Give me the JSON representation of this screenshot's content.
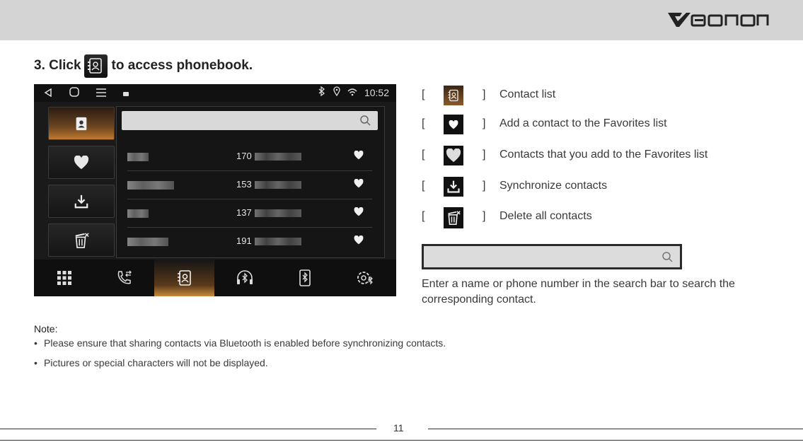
{
  "header": {
    "brand": "EONON"
  },
  "step": {
    "before": "3. Click",
    "after": "to access phonebook."
  },
  "phone": {
    "time": "10:52",
    "contacts": [
      {
        "number": "170"
      },
      {
        "number": "153"
      },
      {
        "number": "137"
      },
      {
        "number": "191"
      }
    ],
    "dock_icons": [
      "apps-grid-icon",
      "call-log-icon",
      "contacts-icon",
      "bluetooth-headset-icon",
      "bluetooth-phone-icon",
      "bluetooth-settings-icon"
    ]
  },
  "legend": [
    {
      "icon": "contact-list-icon",
      "text": "Contact list"
    },
    {
      "icon": "heart-add-icon",
      "text": "Add a contact to the Favorites list"
    },
    {
      "icon": "heart-favorites-icon",
      "text": "Contacts that you add to the Favorites list"
    },
    {
      "icon": "download-icon",
      "text": "Synchronize contacts"
    },
    {
      "icon": "trash-icon",
      "text": "Delete all contacts"
    }
  ],
  "bracket_open": "[",
  "bracket_close": "]",
  "search_description": "Enter a name or phone number in the search bar to search the corresponding contact.",
  "note": {
    "heading": "Note:",
    "bullet": "•",
    "items": [
      "Please ensure that sharing contacts via Bluetooth is enabled before synchronizing contacts.",
      "Pictures or special characters will not be displayed."
    ]
  },
  "page_number": "11",
  "colors": {
    "accent": "#c07a30",
    "topbar": "#d4d4d4"
  }
}
